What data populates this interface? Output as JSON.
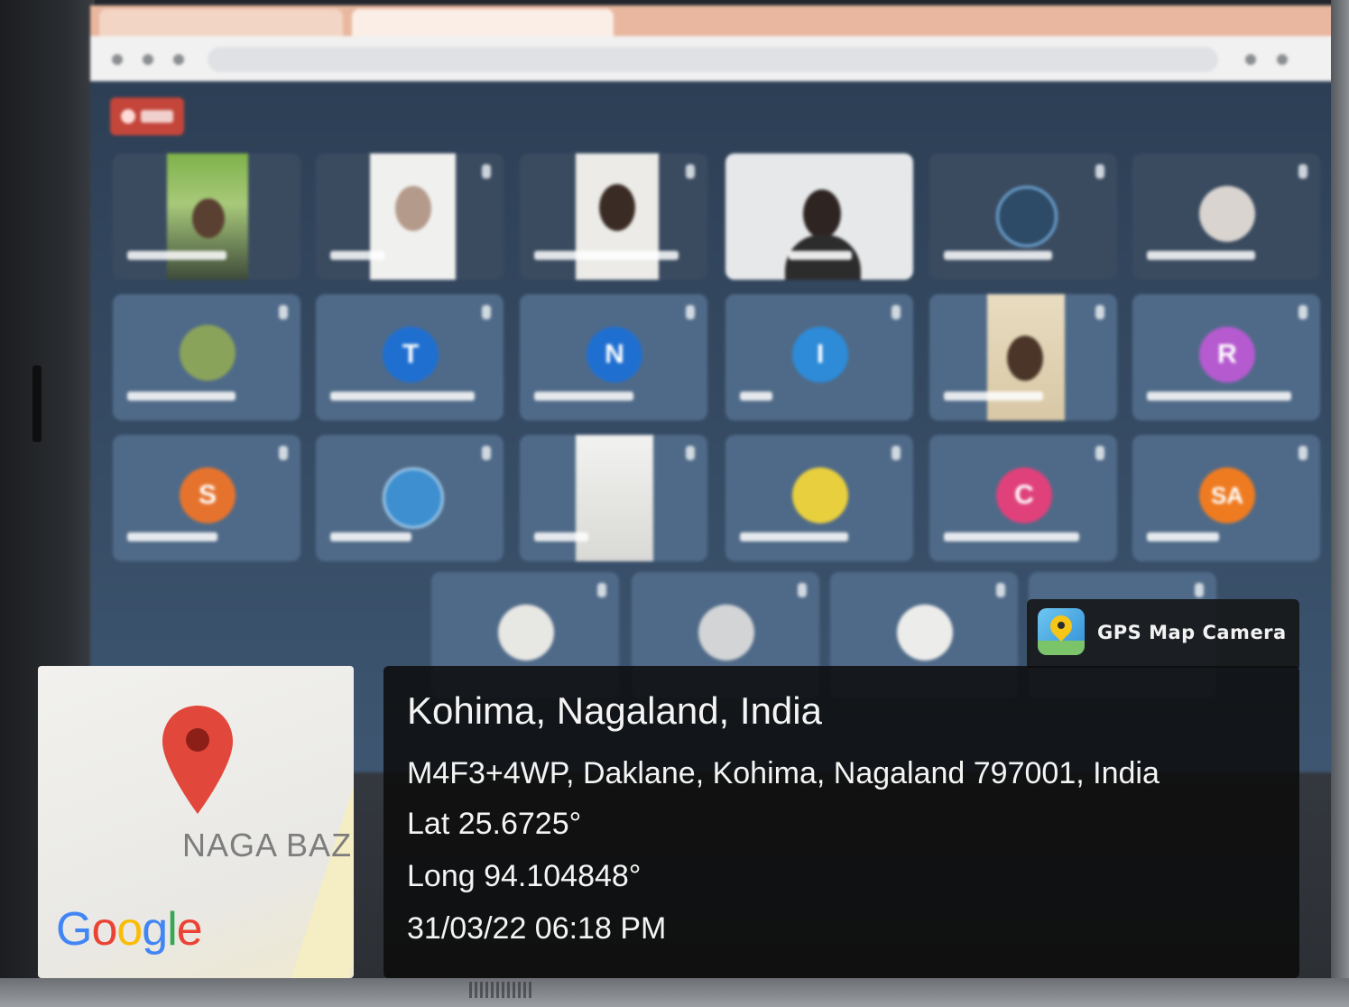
{
  "overlay": {
    "app_name": "GPS Map Camera",
    "place_title": "Kohima, Nagaland, India",
    "address": "M4F3+4WP, Daklane, Kohima, Nagaland 797001, India",
    "latitude": "Lat 25.6725°",
    "longitude": "Long 94.104848°",
    "datetime": "31/03/22 06:18 PM"
  },
  "map_thumbnail": {
    "area_label": "NAGA BAZ",
    "logo": {
      "letters": [
        "G",
        "o",
        "o",
        "g",
        "l",
        "e"
      ]
    },
    "pin_icon": "map-pin-icon"
  },
  "meeting": {
    "avatars": [
      {
        "letter": "T",
        "color": "#1f6fd1"
      },
      {
        "letter": "N",
        "color": "#1f6fd1"
      },
      {
        "letter": "I",
        "color": "#2d8bd8"
      },
      {
        "letter": "R",
        "color": "#b65ad0"
      },
      {
        "letter": "S",
        "color": "#e6732d"
      },
      {
        "letter": "C",
        "color": "#e0417a"
      },
      {
        "letter": "SA",
        "color": "#ef7b21"
      }
    ]
  },
  "colors": {
    "overlay_bg": "#0c0c0c",
    "overlay_text": "#f4f4f4",
    "recording_badge": "#c4453a",
    "screen_bg": "#3b4e63"
  }
}
